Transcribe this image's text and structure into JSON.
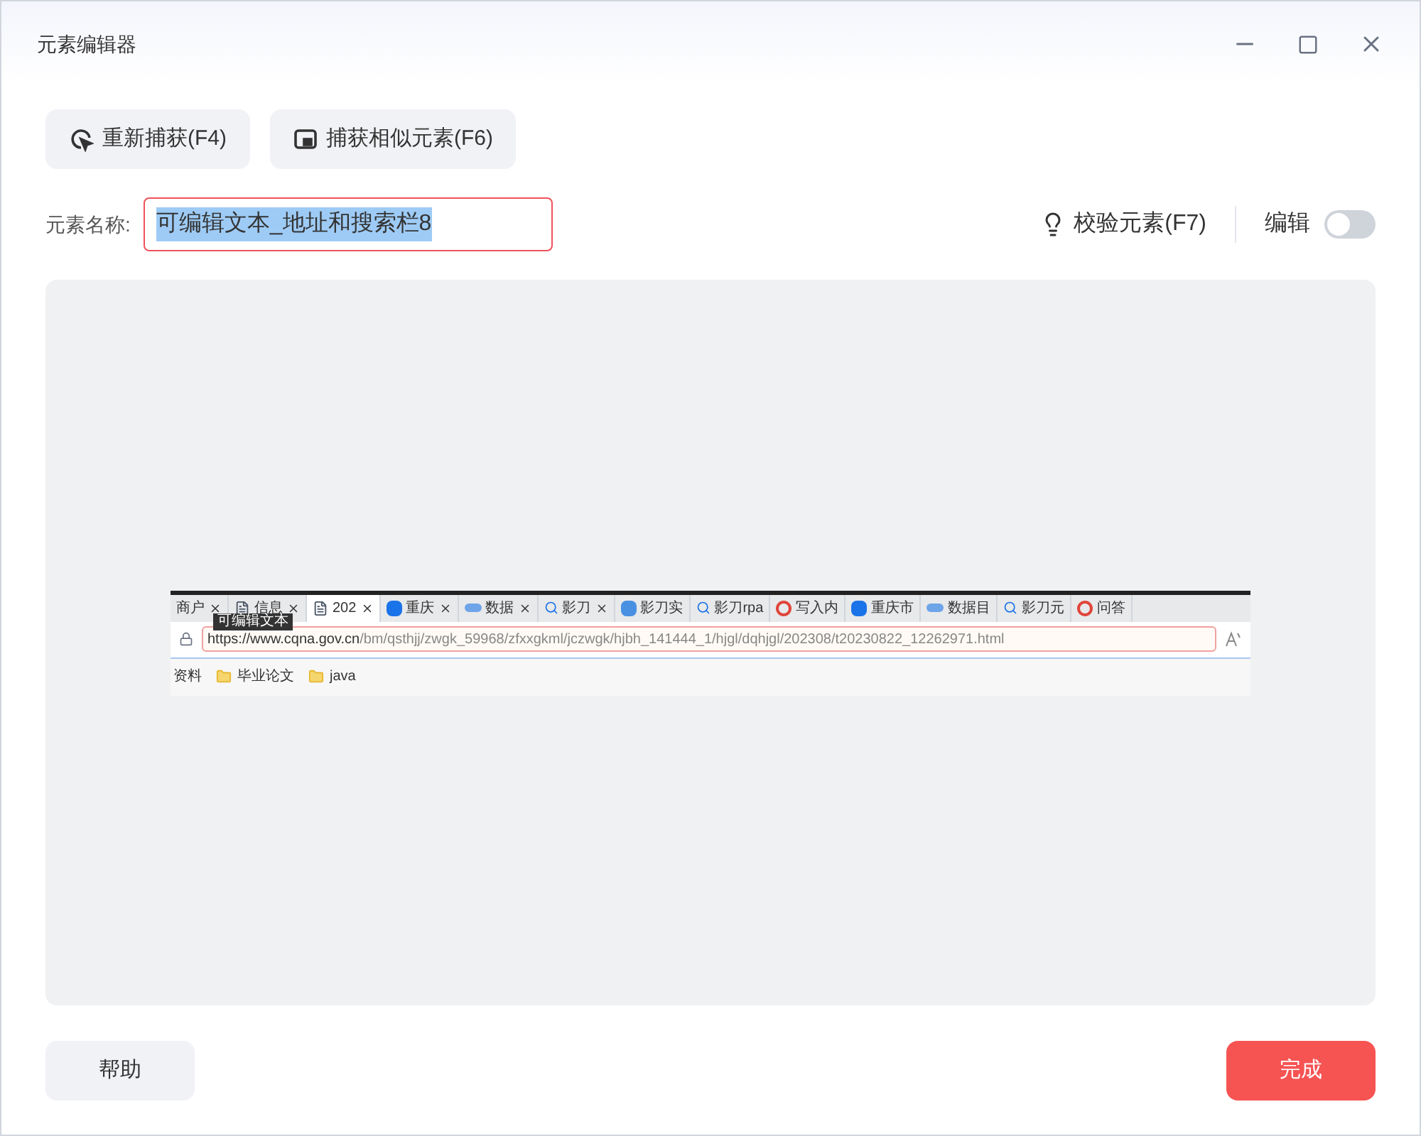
{
  "window": {
    "title": "元素编辑器"
  },
  "toolbar": [
    {
      "kind": "recapture",
      "label": "重新捕获(F4)"
    },
    {
      "kind": "similar",
      "label": "捕获相似元素(F6)"
    }
  ],
  "name_field": {
    "label": "元素名称:",
    "value": "可编辑文本_地址和搜索栏8",
    "selected": true
  },
  "validate": {
    "label": "校验元素(F7)"
  },
  "edit_toggle": {
    "label": "编辑",
    "on": false
  },
  "preview": {
    "tabs": [
      {
        "label": "商户",
        "kind": "plain",
        "selected": false
      },
      {
        "label": "信息",
        "kind": "page",
        "selected": false
      },
      {
        "label": "202",
        "kind": "page",
        "selected": true
      },
      {
        "label": "重庆",
        "kind": "browser",
        "selected": false
      },
      {
        "label": "数据",
        "kind": "data",
        "selected": false
      },
      {
        "label": "影刀",
        "kind": "search",
        "selected": false
      },
      {
        "label": "影刀实",
        "kind": "app",
        "selected": false
      },
      {
        "label": "影刀rpa",
        "kind": "search",
        "selected": false
      },
      {
        "label": "写入内",
        "kind": "ring",
        "selected": false
      },
      {
        "label": "重庆市",
        "kind": "browser",
        "selected": false
      },
      {
        "label": "数据目",
        "kind": "data",
        "selected": false
      },
      {
        "label": "影刀元",
        "kind": "search",
        "selected": false
      },
      {
        "label": "问答",
        "kind": "ring",
        "selected": false
      }
    ],
    "tooltip": "可编辑文本",
    "url_host": "https://www.cqna.gov.cn",
    "url_path": "/bm/qsthjj/zwgk_59968/zfxxgkml/jczwgk/hjbh_141444_1/hjgl/dqhjgl/202308/t20230822_12262971.html",
    "bookmarks": [
      "资料",
      "毕业论文",
      "java"
    ]
  },
  "footer": {
    "help": "帮助",
    "done": "完成"
  }
}
